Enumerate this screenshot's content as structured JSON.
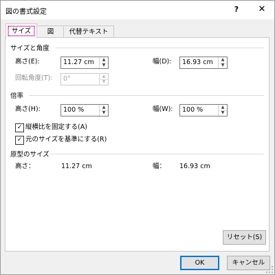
{
  "dialog": {
    "title": "図の書式設定",
    "help": "?",
    "close": "✕"
  },
  "tabs": [
    {
      "label": "サイズ"
    },
    {
      "label": "図"
    },
    {
      "label": "代替テキスト"
    }
  ],
  "size_section": {
    "heading": "サイズと角度",
    "height_label": "高さ(E):",
    "height_value": "11.27 cm",
    "width_label": "幅(D):",
    "width_value": "16.93 cm",
    "rotation_label": "回転角度(T):",
    "rotation_value": "0°"
  },
  "scale_section": {
    "heading": "倍率",
    "height_label": "高さ(H):",
    "height_value": "100 %",
    "width_label": "幅(W):",
    "width_value": "100 %",
    "lock_aspect_label": "縦横比を固定する(A)",
    "lock_aspect_checked": true,
    "relative_label": "元のサイズを基準にする(R)",
    "relative_checked": true
  },
  "original_section": {
    "heading": "原型のサイズ",
    "height_label": "高さ：",
    "height_value": "11.27 cm",
    "width_label": "幅：",
    "width_value": "16.93 cm"
  },
  "buttons": {
    "reset": "リセット(S)",
    "ok": "OK",
    "cancel": "キャンセル"
  },
  "icons": {
    "spin_up": "▲",
    "spin_down": "▼",
    "check": "✓"
  }
}
